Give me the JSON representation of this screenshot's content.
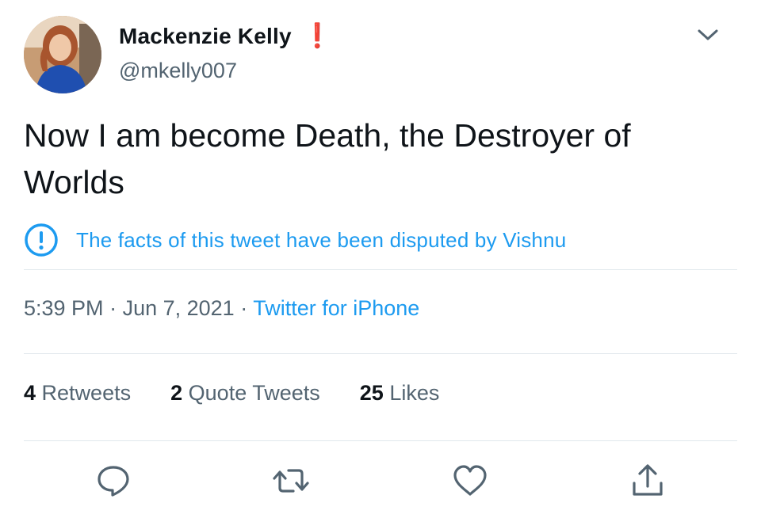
{
  "user": {
    "display_name": "Mackenzie Kelly",
    "handle": "@mkelly007",
    "name_badge": "❗"
  },
  "tweet": {
    "text": "Now I am become Death, the Destroyer of Worlds",
    "dispute_notice": "The facts of this tweet have been disputed by Vishnu"
  },
  "meta": {
    "time": "5:39 PM",
    "separator": " · ",
    "date": "Jun 7, 2021",
    "source": "Twitter for iPhone"
  },
  "stats": [
    {
      "count": "4",
      "label": "Retweets"
    },
    {
      "count": "2",
      "label": "Quote Tweets"
    },
    {
      "count": "25",
      "label": "Likes"
    }
  ],
  "icons": {
    "more": "chevron-down-icon",
    "dispute": "info-circle-icon",
    "reply": "reply-icon",
    "retweet": "retweet-icon",
    "like": "heart-icon",
    "share": "share-icon"
  },
  "colors": {
    "text": "#0f1419",
    "secondary": "#536471",
    "accent": "#1d9bf0",
    "alert": "#e0245e",
    "divider": "#e1e8ed"
  }
}
